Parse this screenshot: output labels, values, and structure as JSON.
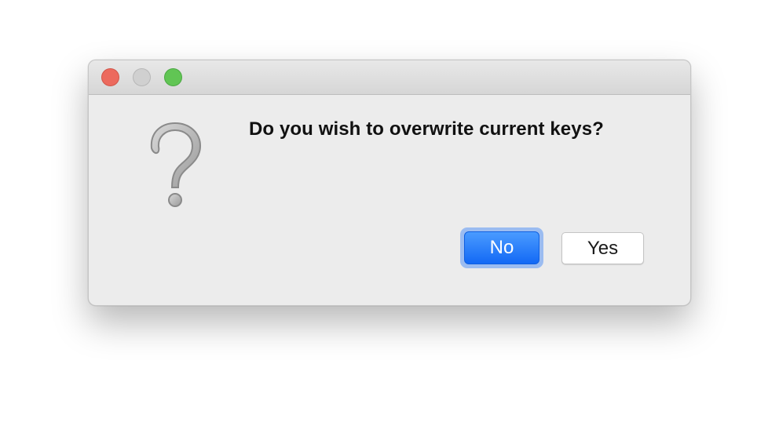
{
  "dialog": {
    "message": "Do you wish to overwrite current keys?",
    "icon": "question-icon",
    "buttons": {
      "no_label": "No",
      "yes_label": "Yes",
      "default": "No"
    }
  },
  "window_controls": [
    "close",
    "minimize",
    "zoom"
  ],
  "colors": {
    "close": "#ec6a5e",
    "minimize_disabled": "#d0d0d0",
    "zoom": "#61c554",
    "default_button": "#1a6ff6",
    "window_background": "#ececec"
  }
}
